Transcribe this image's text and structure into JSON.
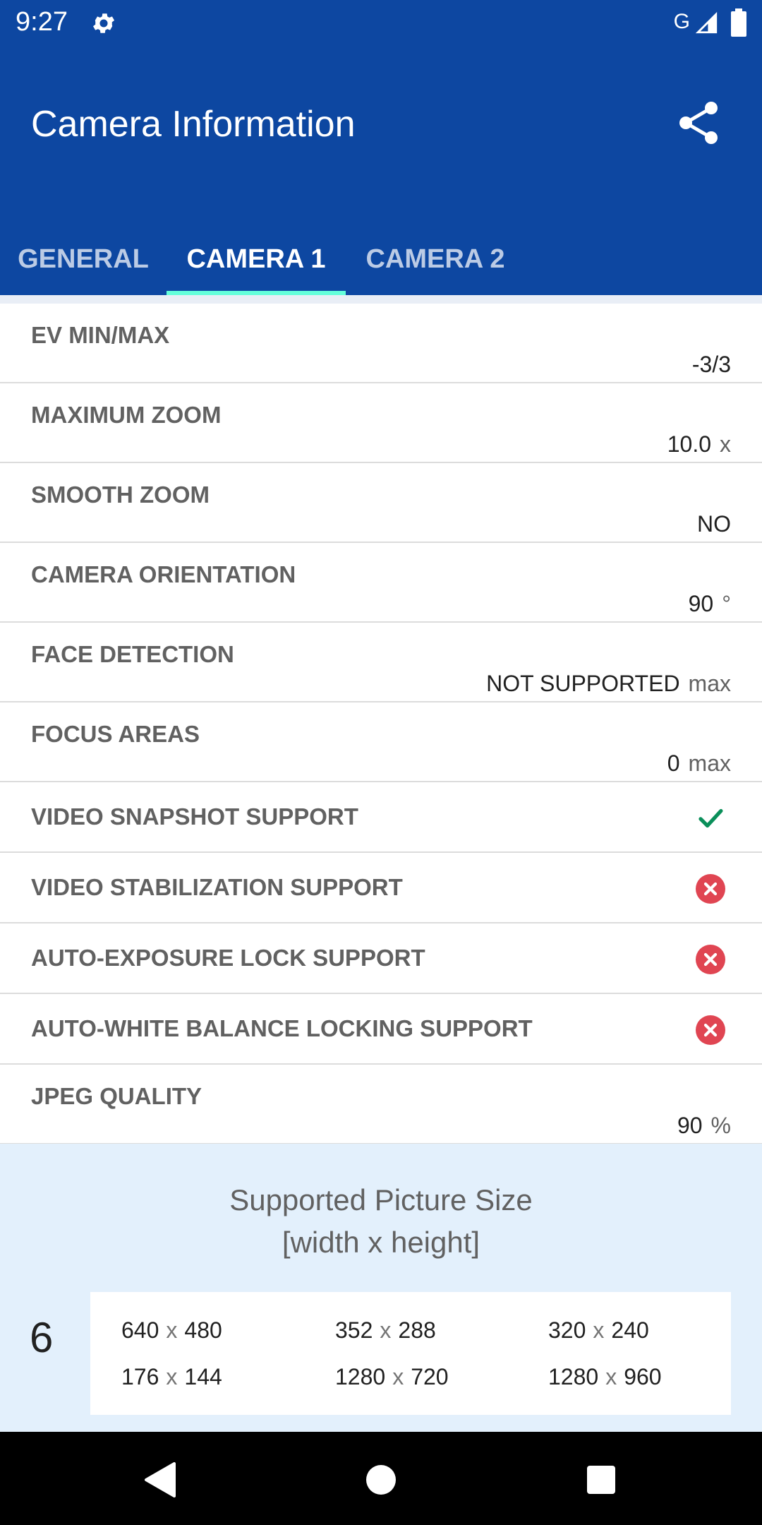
{
  "status_bar": {
    "time": "9:27",
    "network": "G",
    "icons": [
      "gear-icon",
      "signal-icon",
      "battery-icon"
    ]
  },
  "app_bar": {
    "title": "Camera Information",
    "share_icon": "share-icon"
  },
  "tabs": [
    {
      "label": "GENERAL",
      "selected": false
    },
    {
      "label": "CAMERA 1",
      "selected": true
    },
    {
      "label": "CAMERA 2",
      "selected": false
    }
  ],
  "rows": [
    {
      "label": "EV MIN/MAX",
      "value": "-3/3",
      "unit": ""
    },
    {
      "label": "MAXIMUM ZOOM",
      "value": "10.0",
      "unit": "x"
    },
    {
      "label": "SMOOTH ZOOM",
      "value": "NO",
      "unit": ""
    },
    {
      "label": "CAMERA ORIENTATION",
      "value": "90",
      "unit": "°"
    },
    {
      "label": "FACE DETECTION",
      "value": "NOT SUPPORTED",
      "unit": "max"
    },
    {
      "label": "FOCUS AREAS",
      "value": "0",
      "unit": "max"
    },
    {
      "label": "VIDEO SNAPSHOT SUPPORT",
      "icon": "check-icon"
    },
    {
      "label": "VIDEO STABILIZATION SUPPORT",
      "icon": "cross-circle-icon"
    },
    {
      "label": "AUTO-EXPOSURE LOCK SUPPORT",
      "icon": "cross-circle-icon"
    },
    {
      "label": "AUTO-WHITE BALANCE LOCKING SUPPORT",
      "icon": "cross-circle-icon"
    },
    {
      "label": "JPEG QUALITY",
      "value": "90",
      "unit": "%"
    }
  ],
  "picture_sizes": {
    "title_line1": "Supported Picture Size",
    "title_line2": "[width x height]",
    "count": "6",
    "separator": "x",
    "sizes": [
      {
        "w": "640",
        "h": "480"
      },
      {
        "w": "352",
        "h": "288"
      },
      {
        "w": "320",
        "h": "240"
      },
      {
        "w": "176",
        "h": "144"
      },
      {
        "w": "1280",
        "h": "720"
      },
      {
        "w": "1280",
        "h": "960"
      }
    ]
  },
  "colors": {
    "primary": "#0d47a1",
    "tab_indicator": "#64ffda",
    "check": "#0a8f5a",
    "cross": "#e04552",
    "section_bg": "#e3f0fc"
  }
}
